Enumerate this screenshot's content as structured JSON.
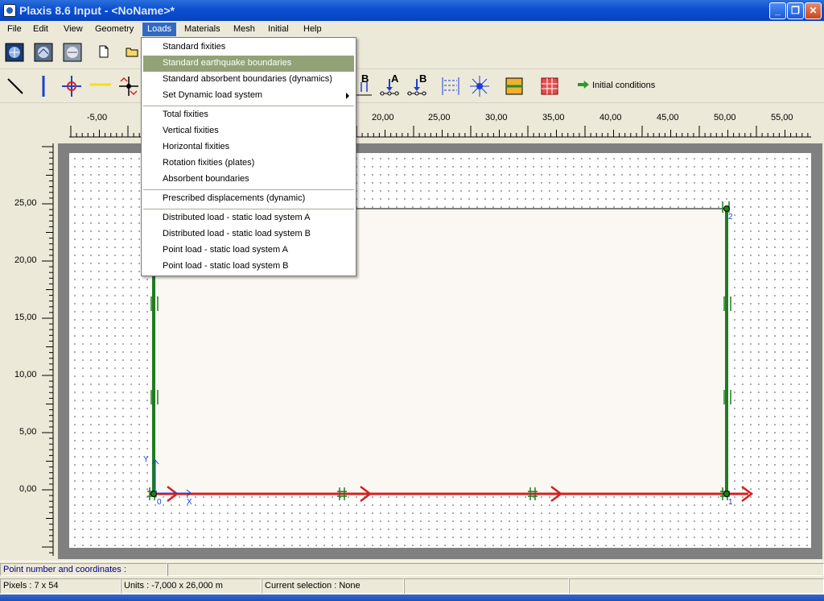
{
  "window": {
    "title": "Plaxis 8.6 Input - <NoName>*",
    "min_label": "_",
    "max_label": "❐",
    "close_label": "✕"
  },
  "menubar": {
    "items": [
      "File",
      "Edit",
      "View",
      "Geometry",
      "Loads",
      "Materials",
      "Mesh",
      "Initial",
      "Help"
    ],
    "open_item": "Loads"
  },
  "toolbar": {
    "initial_conditions_label": "Initial conditions",
    "tool_a_label": "A",
    "tool_b_label": "B",
    "tool_b2_label": "B"
  },
  "loads_menu": {
    "items": [
      {
        "label": "Standard fixities"
      },
      {
        "label": "Standard earthquake boundaries",
        "highlighted": true
      },
      {
        "label": "Standard absorbent boundaries (dynamics)"
      },
      {
        "label": "Set Dynamic load system",
        "submenu": true
      },
      {
        "separator": true
      },
      {
        "label": "Total fixities"
      },
      {
        "label": "Vertical fixities"
      },
      {
        "label": "Horizontal fixities"
      },
      {
        "label": "Rotation fixities (plates)"
      },
      {
        "label": "Absorbent boundaries"
      },
      {
        "separator": true
      },
      {
        "label": "Prescribed displacements (dynamic)"
      },
      {
        "separator": true
      },
      {
        "label": "Distributed load - static load system A"
      },
      {
        "label": "Distributed load - static load system B"
      },
      {
        "label": "Point load - static load system A"
      },
      {
        "label": "Point load - static load system B"
      }
    ]
  },
  "rulers": {
    "horizontal": [
      "-5,00",
      "20,00",
      "25,00",
      "30,00",
      "35,00",
      "40,00",
      "45,00",
      "50,00",
      "55,00"
    ],
    "vertical": [
      "25,00",
      "20,00",
      "15,00",
      "10,00",
      "5,00",
      "0,00"
    ]
  },
  "geometry": {
    "point_labels": [
      "0",
      "1",
      "2"
    ],
    "axis_x_label": "X",
    "axis_y_label": "Y"
  },
  "status": {
    "point_coords_label": "Point number and coordinates :",
    "pixels": "Pixels : 7 x 54",
    "units": "Units  : -7,000 x 26,000 m",
    "selection": "Current selection : None"
  },
  "colors": {
    "plate": "#1e7d1e",
    "prescribed_load": "#d42020",
    "menu_highlight": "#92a276",
    "titlebar": "#0a4fd0"
  }
}
